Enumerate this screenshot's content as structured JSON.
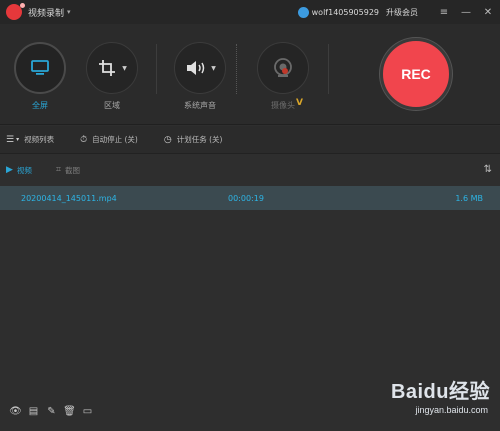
{
  "titlebar": {
    "app_title": "视频录制",
    "caret": "▾",
    "username": "wolf1405905929",
    "upgrade_label": "升级会员",
    "user_caret": "▾",
    "menu_icon": "≡",
    "minimize_icon": "—",
    "close_icon": "✕"
  },
  "toolbar": {
    "fullscreen_label": "全屏",
    "region_label": "区域",
    "system_audio_label": "系统声音",
    "camera_label": "摄像头",
    "camera_badge": "V",
    "rec_label": "REC",
    "accent_color": "#2aa7d7",
    "rec_color": "#f1454d"
  },
  "options": {
    "video_list_label": "视频列表",
    "auto_stop_label": "自动停止 (关)",
    "scheduled_task_label": "计划任务 (关)"
  },
  "tabs": {
    "video_label": "视频",
    "screenshot_label": "截图"
  },
  "files": [
    {
      "name": "20200414_145011.mp4",
      "duration": "00:00:19",
      "size": "1.6 MB"
    }
  ],
  "watermark": {
    "logo": "Baidu经验",
    "url": "jingyan.baidu.com"
  }
}
